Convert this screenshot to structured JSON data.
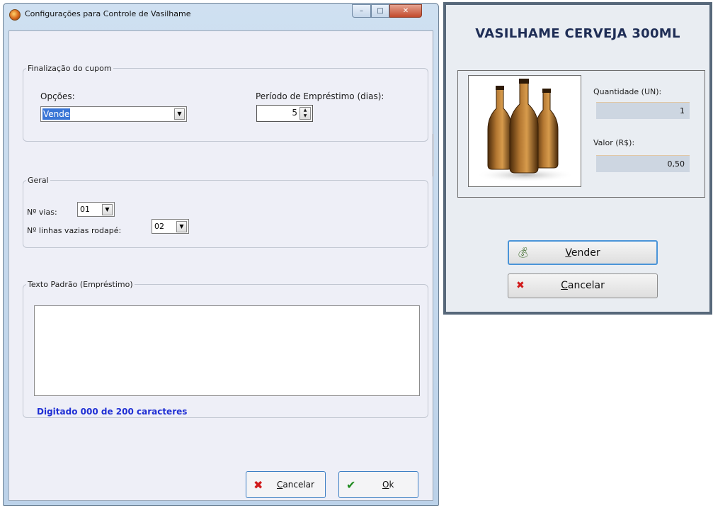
{
  "config_window": {
    "title": "Configurações para Controle de Vasilhame",
    "controls": {
      "minimize": "–",
      "maximize": "□",
      "close": "✕"
    },
    "finalizacao": {
      "legend": "Finalização do cupom",
      "opcoes_label": "Opções:",
      "opcoes_value": "Vende",
      "periodo_label": "Período de Empréstimo (dias):",
      "periodo_value": "5"
    },
    "geral": {
      "legend": "Geral",
      "vias_label": "Nº vias:",
      "vias_value": "01",
      "linhas_label": "Nº linhas vazias rodapé:",
      "linhas_value": "02"
    },
    "texto_padrao": {
      "legend": "Texto Padrão (Empréstimo)",
      "value": "",
      "counter": "Digitado 000 de 200 caracteres"
    },
    "buttons": {
      "cancel_mnemonic": "C",
      "cancel_rest": "ancelar",
      "ok_mnemonic": "O",
      "ok_rest": "k"
    },
    "icons": {
      "cancel": "x-icon",
      "ok": "checkmark-icon",
      "app": "app-icon"
    },
    "colors": {
      "cancel_icon": "#d11b1b",
      "ok_icon": "#1e8a1e",
      "counter_text": "#1f2fd4"
    }
  },
  "product_window": {
    "title": "VASILHAME CERVEJA 300ML",
    "quantidade_label": "Quantidade (UN):",
    "quantidade_value": "1",
    "valor_label": "Valor (R$):",
    "valor_value": "0,50",
    "buttons": {
      "vender_mnemonic": "V",
      "vender_rest": "ender",
      "cancelar_mnemonic": "C",
      "cancelar_rest": "ancelar"
    },
    "icons": {
      "vender": "money-bag-icon",
      "cancelar": "x-icon",
      "image": "beer-bottles-image"
    },
    "colors": {
      "title": "#1e2d55",
      "border": "#57687a"
    }
  }
}
